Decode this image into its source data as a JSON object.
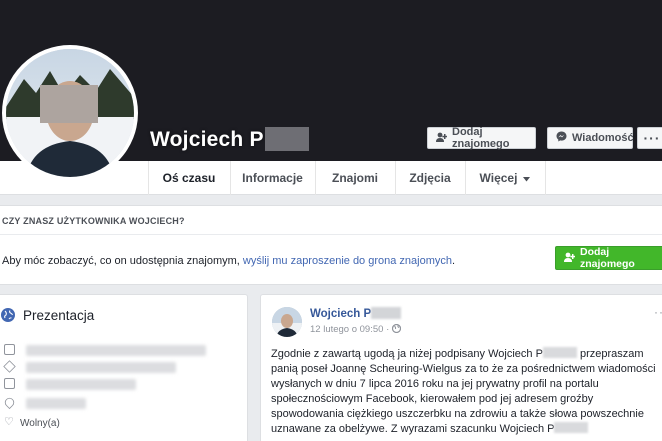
{
  "profile": {
    "name": "Wojciech P",
    "add_friend_label": "Dodaj znajomego",
    "message_label": "Wiadomość",
    "more_label": "···"
  },
  "tabs": [
    {
      "label": "Oś czasu",
      "active": true
    },
    {
      "label": "Informacje",
      "active": false
    },
    {
      "label": "Znajomi",
      "active": false
    },
    {
      "label": "Zdjęcia",
      "active": false
    },
    {
      "label": "Więcej",
      "active": false
    }
  ],
  "know_box": {
    "heading": "CZY ZNASZ UŻYTKOWNIKA WOJCIECH?",
    "text_before": "Aby móc zobaczyć, co on udostępnia znajomym, ",
    "link_text": "wyślij mu zaproszenie do grona znajomych",
    "text_after": ".",
    "button_label": "Dodaj znajomego"
  },
  "intro": {
    "title": "Prezentacja",
    "relationship": "Wolny(a)"
  },
  "post": {
    "author": "Wojciech P",
    "timestamp": "12 lutego o 09:50 · ",
    "more_label": "··",
    "body_1": "Zgodnie z zawartą ugodą ja niżej podpisany Wojciech P",
    "body_2": "przepraszam panią poseł Joannę Scheuring-Wielgus za to że za pośrednictwem wiadomości wysłanych w dniu 7 lipca 2016 roku na jej prywatny profil na portalu społecznościowym Facebook, kierowałem pod jej adresem groźby spowodowania ciężkiego uszczerbku na zdrowiu a także słowa powszechnie uznawane za obelżywe. Z wyrazami szacunku Wojciech P"
  },
  "colors": {
    "cover": "#1c1c22",
    "link": "#4267b2",
    "green_button": "#42b72a"
  }
}
